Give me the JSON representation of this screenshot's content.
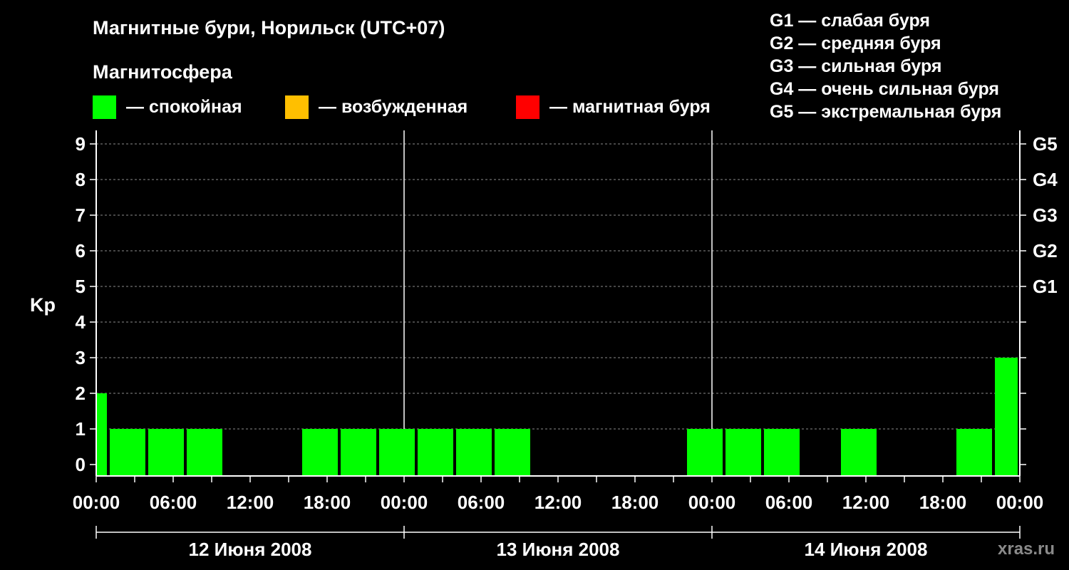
{
  "title": "Магнитные бури, Норильск (UTC+07)",
  "magnetosphere_label": "Магнитосфера",
  "status_legend": [
    {
      "color": "#00ff00",
      "label": "— спокойная"
    },
    {
      "color": "#ffbf00",
      "label": "— возбужденная"
    },
    {
      "color": "#ff0000",
      "label": "— магнитная буря"
    }
  ],
  "g_legend": [
    "G1 — слабая буря",
    "G2 — средняя буря",
    "G3 — сильная буря",
    "G4 — очень сильная буря",
    "G5 — экстремальная буря"
  ],
  "watermark": "xras.ru",
  "chart_data": {
    "type": "bar",
    "ylabel": "Kp",
    "ylim": [
      0,
      9
    ],
    "yticks": [
      0,
      1,
      2,
      3,
      4,
      5,
      6,
      7,
      8,
      9
    ],
    "right_axis_labels": [
      {
        "kp": 5,
        "label": "G1"
      },
      {
        "kp": 6,
        "label": "G2"
      },
      {
        "kp": 7,
        "label": "G3"
      },
      {
        "kp": 8,
        "label": "G4"
      },
      {
        "kp": 9,
        "label": "G5"
      }
    ],
    "x_tick_labels": [
      "00:00",
      "06:00",
      "12:00",
      "18:00",
      "00:00",
      "06:00",
      "12:00",
      "18:00",
      "00:00",
      "06:00",
      "12:00",
      "18:00",
      "00:00"
    ],
    "days": [
      "12 Июня 2008",
      "13 Июня 2008",
      "14 Июня 2008"
    ],
    "grid": true,
    "bars": [
      {
        "day": "12 Июня 2008",
        "start": "00:00",
        "end": "01:00",
        "kp": 2,
        "color": "#00ff00"
      },
      {
        "day": "12 Июня 2008",
        "start": "01:00",
        "end": "04:00",
        "kp": 1,
        "color": "#00ff00"
      },
      {
        "day": "12 Июня 2008",
        "start": "04:00",
        "end": "07:00",
        "kp": 1,
        "color": "#00ff00"
      },
      {
        "day": "12 Июня 2008",
        "start": "07:00",
        "end": "10:00",
        "kp": 1,
        "color": "#00ff00"
      },
      {
        "day": "12 Июня 2008",
        "start": "10:00",
        "end": "13:00",
        "kp": 0,
        "color": "#00ff00"
      },
      {
        "day": "12 Июня 2008",
        "start": "13:00",
        "end": "16:00",
        "kp": 0,
        "color": "#00ff00"
      },
      {
        "day": "12 Июня 2008",
        "start": "16:00",
        "end": "19:00",
        "kp": 1,
        "color": "#00ff00"
      },
      {
        "day": "12 Июня 2008",
        "start": "19:00",
        "end": "22:00",
        "kp": 1,
        "color": "#00ff00"
      },
      {
        "day": "12 Июня 2008",
        "start": "22:00",
        "end": "01:00",
        "kp": 1,
        "color": "#00ff00"
      },
      {
        "day": "13 Июня 2008",
        "start": "01:00",
        "end": "04:00",
        "kp": 1,
        "color": "#00ff00"
      },
      {
        "day": "13 Июня 2008",
        "start": "04:00",
        "end": "07:00",
        "kp": 1,
        "color": "#00ff00"
      },
      {
        "day": "13 Июня 2008",
        "start": "07:00",
        "end": "10:00",
        "kp": 1,
        "color": "#00ff00"
      },
      {
        "day": "13 Июня 2008",
        "start": "10:00",
        "end": "13:00",
        "kp": 0,
        "color": "#00ff00"
      },
      {
        "day": "13 Июня 2008",
        "start": "13:00",
        "end": "16:00",
        "kp": 0,
        "color": "#00ff00"
      },
      {
        "day": "13 Июня 2008",
        "start": "16:00",
        "end": "19:00",
        "kp": 0,
        "color": "#00ff00"
      },
      {
        "day": "13 Июня 2008",
        "start": "19:00",
        "end": "22:00",
        "kp": 0,
        "color": "#00ff00"
      },
      {
        "day": "13 Июня 2008",
        "start": "22:00",
        "end": "01:00",
        "kp": 1,
        "color": "#00ff00"
      },
      {
        "day": "14 Июня 2008",
        "start": "01:00",
        "end": "04:00",
        "kp": 1,
        "color": "#00ff00"
      },
      {
        "day": "14 Июня 2008",
        "start": "04:00",
        "end": "07:00",
        "kp": 1,
        "color": "#00ff00"
      },
      {
        "day": "14 Июня 2008",
        "start": "07:00",
        "end": "10:00",
        "kp": 0,
        "color": "#00ff00"
      },
      {
        "day": "14 Июня 2008",
        "start": "10:00",
        "end": "13:00",
        "kp": 1,
        "color": "#00ff00"
      },
      {
        "day": "14 Июня 2008",
        "start": "13:00",
        "end": "16:00",
        "kp": 0,
        "color": "#00ff00"
      },
      {
        "day": "14 Июня 2008",
        "start": "16:00",
        "end": "19:00",
        "kp": 0,
        "color": "#00ff00"
      },
      {
        "day": "14 Июня 2008",
        "start": "19:00",
        "end": "22:00",
        "kp": 1,
        "color": "#00ff00"
      },
      {
        "day": "14 Июня 2008",
        "start": "22:00",
        "end": "00:00",
        "kp": 3,
        "color": "#00ff00"
      }
    ]
  }
}
